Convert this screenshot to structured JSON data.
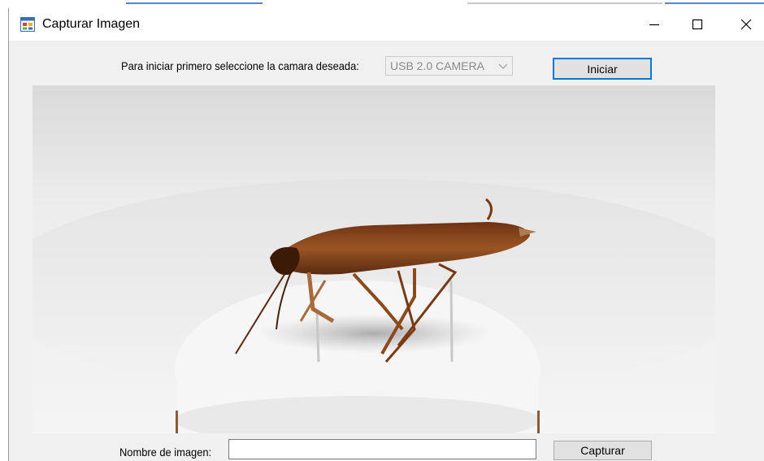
{
  "window": {
    "title": "Capturar Imagen",
    "icon": "app-form-icon",
    "controls": [
      "minimize-icon",
      "maximize-icon",
      "close-icon"
    ]
  },
  "camera": {
    "prompt": "Para iniciar primero seleccione la camara deseada:",
    "selected": "USB 2.0 CAMERA",
    "start_label": "Iniciar"
  },
  "preview": {
    "content": "camera-preview-image"
  },
  "capture": {
    "name_label": "Nombre de imagen:",
    "name_value": "",
    "capture_label": "Capturar"
  },
  "colors": {
    "accent": "#0078d7",
    "window_bg": "#f0f0f0",
    "button_bg": "#e1e1e1"
  }
}
